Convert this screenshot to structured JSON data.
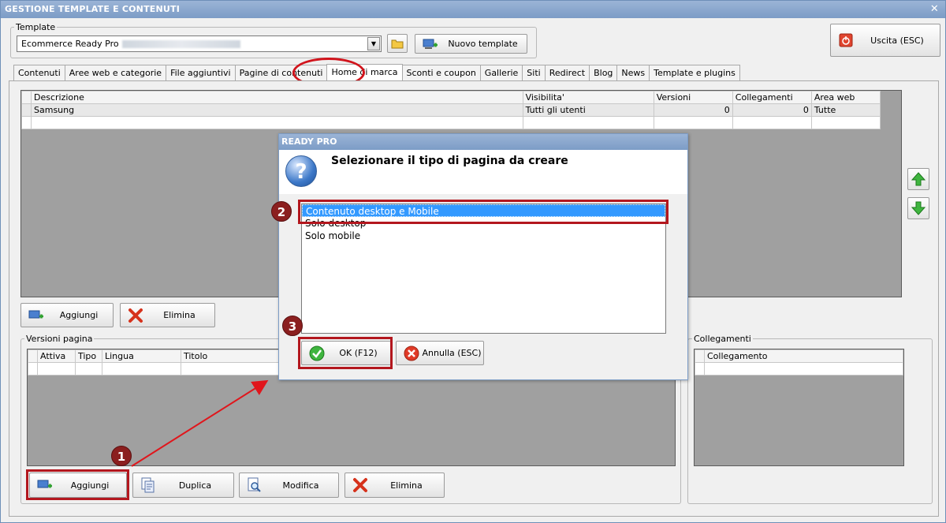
{
  "window": {
    "title": "GESTIONE TEMPLATE E CONTENUTI",
    "close": "✕"
  },
  "template_group": {
    "label": "Template",
    "selected": "Ecommerce Ready Pro",
    "new_button": "Nuovo template"
  },
  "exit_button": "Uscita (ESC)",
  "tabs": [
    "Contenuti",
    "Aree web e categorie",
    "File aggiuntivi",
    "Pagine di contenuti",
    "Home di marca",
    "Sconti e coupon",
    "Gallerie",
    "Siti",
    "Redirect",
    "Blog",
    "News",
    "Template e plugins"
  ],
  "active_tab": "Home di marca",
  "brand_table": {
    "columns": [
      "Descrizione",
      "Visibilita'",
      "Versioni",
      "Collegamenti",
      "Area web"
    ],
    "rows": [
      {
        "descrizione": "Samsung",
        "visibilita": "Tutti gli utenti",
        "versioni": "0",
        "collegamenti": "0",
        "area_web": "Tutte"
      }
    ]
  },
  "top_buttons": {
    "add": "Aggiungi",
    "delete": "Elimina"
  },
  "versions_group": {
    "label": "Versioni pagina",
    "columns": [
      "Attiva",
      "Tipo",
      "Lingua",
      "Titolo"
    ]
  },
  "links_group": {
    "label": "Collegamenti",
    "columns": [
      "Collegamento"
    ]
  },
  "bottom_buttons": {
    "add": "Aggiungi",
    "duplicate": "Duplica",
    "modify": "Modifica",
    "delete": "Elimina"
  },
  "dialog": {
    "title": "READY PRO",
    "question": "Selezionare il tipo di pagina da creare",
    "options": [
      "Contenuto desktop e Mobile",
      "Solo desktop",
      "Solo mobile"
    ],
    "selected_option": "Contenuto desktop e Mobile",
    "ok": "OK (F12)",
    "cancel": "Annulla (ESC)"
  },
  "callouts": [
    "1",
    "2",
    "3"
  ],
  "colors": {
    "titlebar": "#7c9cc6",
    "selection": "#3399ff",
    "callout": "#8b1f1f",
    "highlight": "#b3171e"
  }
}
